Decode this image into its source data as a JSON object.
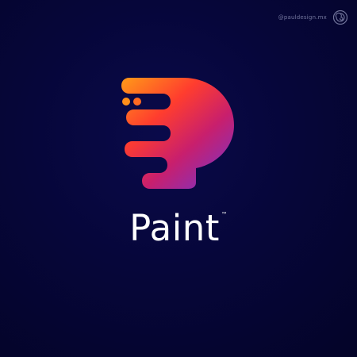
{
  "watermark": {
    "handle": "@pauldesign.mx",
    "icon": "spiral-logo-icon"
  },
  "logo": {
    "icon": "paint-p-logo-icon",
    "gradient": [
      "#FF9A18",
      "#FF3D2E",
      "#C81F6D",
      "#7A33C8"
    ]
  },
  "brand": {
    "name": "Paint",
    "trademark": "™"
  },
  "colors": {
    "background": "#06063A",
    "text": "#FFFFFF",
    "watermark_text": "#ADB2D6"
  }
}
